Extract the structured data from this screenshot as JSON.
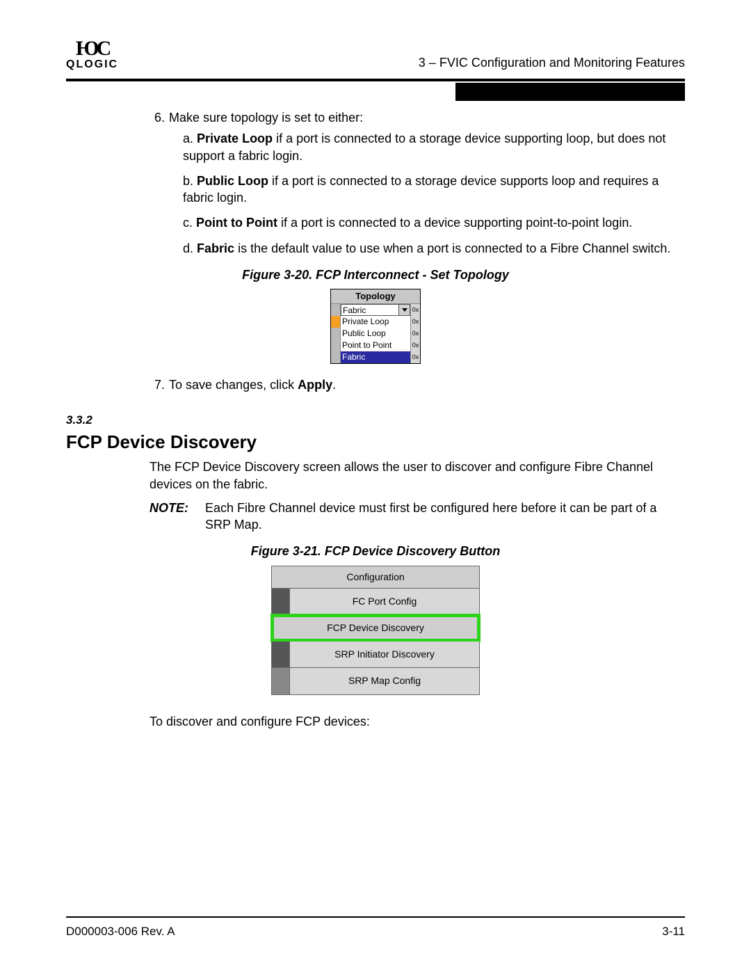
{
  "header": {
    "logo_text": "QLOGIC",
    "title": "3 – FVIC Configuration and Monitoring Features"
  },
  "steps": {
    "six": {
      "num": "6.",
      "text": "Make sure topology is set to either:"
    },
    "a": {
      "letter": "a.",
      "bold": "Private Loop",
      "rest": " if a port is connected to a storage device supporting loop, but does not support a fabric login."
    },
    "b": {
      "letter": "b.",
      "bold": "Public Loop",
      "rest": " if a port is connected to a storage device supports loop and requires a fabric login."
    },
    "c": {
      "letter": "c.",
      "bold": "Point to Point",
      "rest": " if a port is connected to a device supporting point-to-point login."
    },
    "d": {
      "letter": "d.",
      "bold": "Fabric",
      "rest": " is the default value to use when a port is connected to a Fibre Channel switch."
    },
    "seven": {
      "num": "7.",
      "before": "To save changes, click ",
      "bold": "Apply",
      "after": "."
    }
  },
  "fig20": {
    "caption": "Figure 3-20. FCP Interconnect - Set Topology",
    "header": "Topology",
    "selected": "Fabric",
    "options": [
      "Private Loop",
      "Public Loop",
      "Point to Point",
      "Fabric"
    ],
    "chip": "0x"
  },
  "section": {
    "num": "3.3.2",
    "title": "FCP Device Discovery",
    "intro": "The FCP Device Discovery screen allows the user to discover and configure Fibre Channel devices on the fabric.",
    "note_label": "NOTE:",
    "note_text": "Each Fibre Channel device must first be configured here before it can be part of a SRP Map."
  },
  "fig21": {
    "caption": "Figure 3-21. FCP Device Discovery Button",
    "header": "Configuration",
    "items": [
      "FC Port Config",
      "FCP Device Discovery",
      "SRP Initiator Discovery",
      "SRP Map Config"
    ]
  },
  "closing": "To discover and configure FCP devices:",
  "footer": {
    "left": "D000003-006 Rev. A",
    "right": "3-11"
  }
}
